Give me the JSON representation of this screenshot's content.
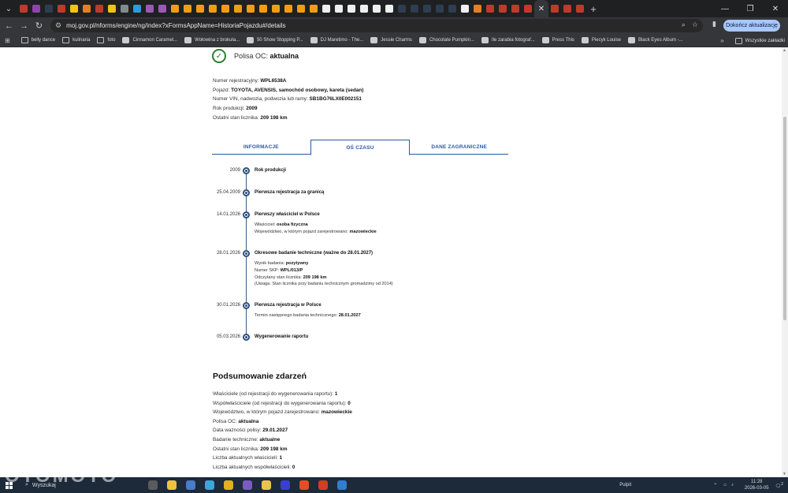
{
  "browser": {
    "tab_favicon_colors": [
      "#c0392b",
      "#8e44ad",
      "#2c3e50",
      "#c0392b",
      "#f1c40f",
      "#e67e22",
      "#c0392b",
      "#f1c40f",
      "#7f8c8d",
      "#3498db",
      "#9b59b6",
      "#9b59b6",
      "#f39c12",
      "#f39c12",
      "#f39c12",
      "#f39c12",
      "#f39c12",
      "#f39c12",
      "#f39c12",
      "#f39c12",
      "#f39c12",
      "#f39c12",
      "#f39c12",
      "#f39c12",
      "#ecf0f1",
      "#ecf0f1",
      "#ecf0f1",
      "#ecf0f1",
      "#ecf0f1",
      "#ecf0f1",
      "#2c3e50",
      "#2c3e50",
      "#2c3e50",
      "#2c3e50",
      "#2c3e50",
      "#ecf0f1",
      "#e67e22",
      "#c0392b",
      "#c0392b",
      "#c0392b",
      "#c0392b",
      "#c0392b",
      "#c0392b",
      "#c0392b"
    ],
    "url": "moj.gov.pl/nforms/engine/ng/index?xFormsAppName=HistoriaPojazdu#/details",
    "update_button": "Dokończ aktualizację",
    "bookmarks": [
      {
        "label": "belly dance",
        "icon": "folder-icon"
      },
      {
        "label": "kulinaria",
        "icon": "folder-icon"
      },
      {
        "label": "foto",
        "icon": "folder-icon"
      },
      {
        "label": "Cinnamon Caramel...",
        "icon": "site-icon"
      },
      {
        "label": "Wołowina z brokuła...",
        "icon": "site-icon"
      },
      {
        "label": "50 Show Stopping P...",
        "icon": "site-icon"
      },
      {
        "label": "DJ Maretimo - The...",
        "icon": "site-icon"
      },
      {
        "label": "Jessie Charms",
        "icon": "site-icon"
      },
      {
        "label": "Chocolate Pumpkin...",
        "icon": "site-icon"
      },
      {
        "label": "Ile zarabia fotograf...",
        "icon": "site-icon"
      },
      {
        "label": "Press This",
        "icon": "site-icon"
      },
      {
        "label": "Piecyk Louise",
        "icon": "site-icon"
      },
      {
        "label": "Black Eyes Album -...",
        "icon": "site-icon"
      }
    ],
    "all_bookmarks": "Wszystkie zakładki"
  },
  "page": {
    "polisa": {
      "label": "Polisa OC:",
      "value": "aktualna"
    },
    "vehicle": {
      "reg_label": "Numer rejestracyjny:",
      "reg_value": "WPL6538A",
      "vehicle_label": "Pojazd:",
      "vehicle_value": "TOYOTA, AVENSIS, samochód osobowy, kareta (sedan)",
      "vin_label": "Numer VIN, nadwozia, podwozia lub ramy:",
      "vin_value": "SB1BG76LX0E002151",
      "year_label": "Rok produkcji:",
      "year_value": "2009",
      "odo_label": "Ostatni stan licznika:",
      "odo_value": "209 198 km"
    },
    "tabs": [
      "INFORMACJE",
      "OŚ CZASU",
      "DANE ZAGRANICZNE"
    ],
    "timeline": [
      {
        "date": "2009",
        "title": "Rok produkcji",
        "details": []
      },
      {
        "date": "25.04.2009",
        "title": "Pierwsza rejestracja za granicą",
        "details": []
      },
      {
        "date": "14.01.2026",
        "title": "Pierwszy właściciel w Polsce",
        "details": [
          {
            "label": "Właściciel:",
            "value": "osoba fizyczna"
          },
          {
            "label": "Województwo, w którym pojazd zarejestrowano:",
            "value": "mazowieckie"
          }
        ]
      },
      {
        "date": "28.01.2026",
        "title": "Okresowe badanie techniczne (ważne do 28.01.2027)",
        "details": [
          {
            "label": "Wynik badania:",
            "value": "pozytywny"
          },
          {
            "label": "Numer SKP:",
            "value": "WPL/013/P"
          },
          {
            "label": "Odczytany stan licznika:",
            "value": "209 198 km"
          },
          {
            "label": "(Uwaga. Stan licznika przy badaniu technicznym gromadzimy od 2014)",
            "value": ""
          }
        ]
      },
      {
        "date": "30.01.2026",
        "title": "Pierwsza rejestracja w Polsce",
        "details": [
          {
            "label": "Termin następnego badania technicznego:",
            "value": "28.01.2027"
          }
        ]
      },
      {
        "date": "05.03.2026",
        "title": "Wygenerowanie raportu",
        "details": []
      }
    ],
    "summary": {
      "title": "Podsumowanie zdarzeń",
      "rows": [
        {
          "label": "Właściciele (od rejestracji do wygenerowania raportu):",
          "value": "1"
        },
        {
          "label": "Współwłaściciele (od rejestracji do wygenerowania raportu):",
          "value": "0"
        },
        {
          "label": "Województwo, w którym pojazd zarejestrowano:",
          "value": "mazowieckie"
        },
        {
          "label": "Polisa OC:",
          "value": "aktualna"
        },
        {
          "label": "Data ważności polisy:",
          "value": "29.01.2027"
        },
        {
          "label": "Badanie techniczne:",
          "value": "aktualne"
        },
        {
          "label": "Ostatni stan licznika:",
          "value": "209 198 km"
        },
        {
          "label": "Liczba aktualnych właścicieli:",
          "value": "1"
        },
        {
          "label": "Liczba aktualnych współwłaścicieli:",
          "value": "0"
        }
      ]
    }
  },
  "taskbar": {
    "search_placeholder": "Wyszukaj",
    "apps": [
      "#5b5b5b",
      "#f0c040",
      "#4a7cc7",
      "#3da5d9",
      "#e0b020",
      "#7a5cc0",
      "#e8c54a",
      "#3a3fd1",
      "#e44d26",
      "#d04020",
      "#2f7dd1"
    ],
    "desktop_label": "Pulpit",
    "time": "11:28",
    "date": "2026-03-05",
    "notif_count": "2"
  },
  "watermark": "OTOMOTO"
}
